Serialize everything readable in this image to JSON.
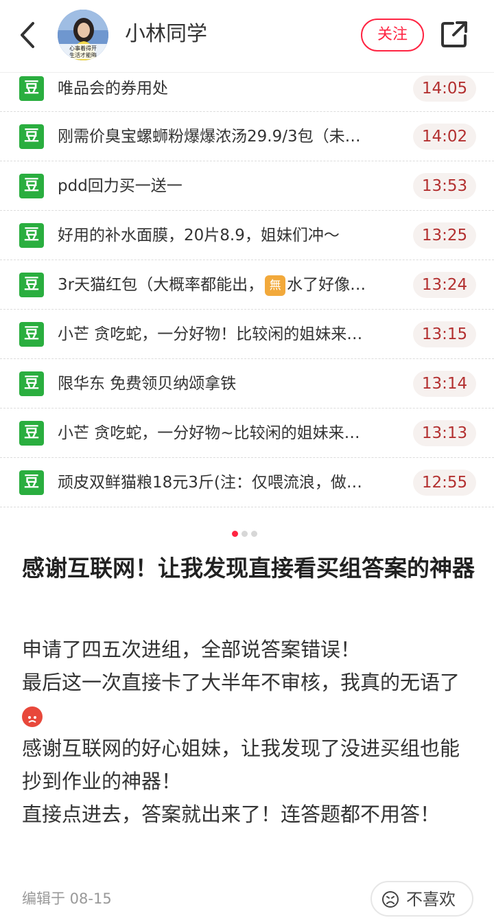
{
  "header": {
    "author_name": "小林同学",
    "avatar_text_line1": "心事着得开",
    "avatar_text_line2": "生活才能晦",
    "follow_label": "关注"
  },
  "list": [
    {
      "icon": "豆",
      "title": "唯品会的券用处",
      "time": "14:05"
    },
    {
      "icon": "豆",
      "title": "刚需价臭宝螺蛳粉爆爆浓汤29.9/3包（未…",
      "time": "14:02"
    },
    {
      "icon": "豆",
      "title": "pdd回力买一送一",
      "time": "13:53"
    },
    {
      "icon": "豆",
      "title": "好用的补水面膜，20片8.9，姐妹们冲～",
      "time": "13:25"
    },
    {
      "icon": "豆",
      "title_pre": "3r天猫红包（大概率都能出，",
      "title_badge": "無",
      "title_post": "水了好像…",
      "time": "13:24"
    },
    {
      "icon": "豆",
      "title": "小芒 贪吃蛇，一分好物！比较闲的姐妹来…",
      "time": "13:15"
    },
    {
      "icon": "豆",
      "title": "限华东 免费领贝纳颂拿铁",
      "time": "13:14"
    },
    {
      "icon": "豆",
      "title": "小芒 贪吃蛇，一分好物~比较闲的姐妹来…",
      "time": "13:13"
    },
    {
      "icon": "豆",
      "title": "顽皮双鲜猫粮18元3斤(注：仅喂流浪，做…",
      "time": "12:55"
    }
  ],
  "article": {
    "title": "感谢互联网！让我发现直接看买组答案的神器",
    "body": [
      "申请了四五次进组，全部说答案错误！",
      "最后这一次直接卡了大半年不审核，我真的无语了",
      "感谢互联网的好心姐妹，让我发现了没进买组也能抄到作业的神器！",
      "直接点进去，答案就出来了！连答题都不用答！"
    ]
  },
  "footer": {
    "edit_info": "编辑于 08-15",
    "dislike_label": "不喜欢"
  },
  "colors": {
    "accent": "#ff2442",
    "douban_green": "#2aae3f",
    "time_text": "#b33030",
    "time_bg": "#f6f1ef"
  }
}
